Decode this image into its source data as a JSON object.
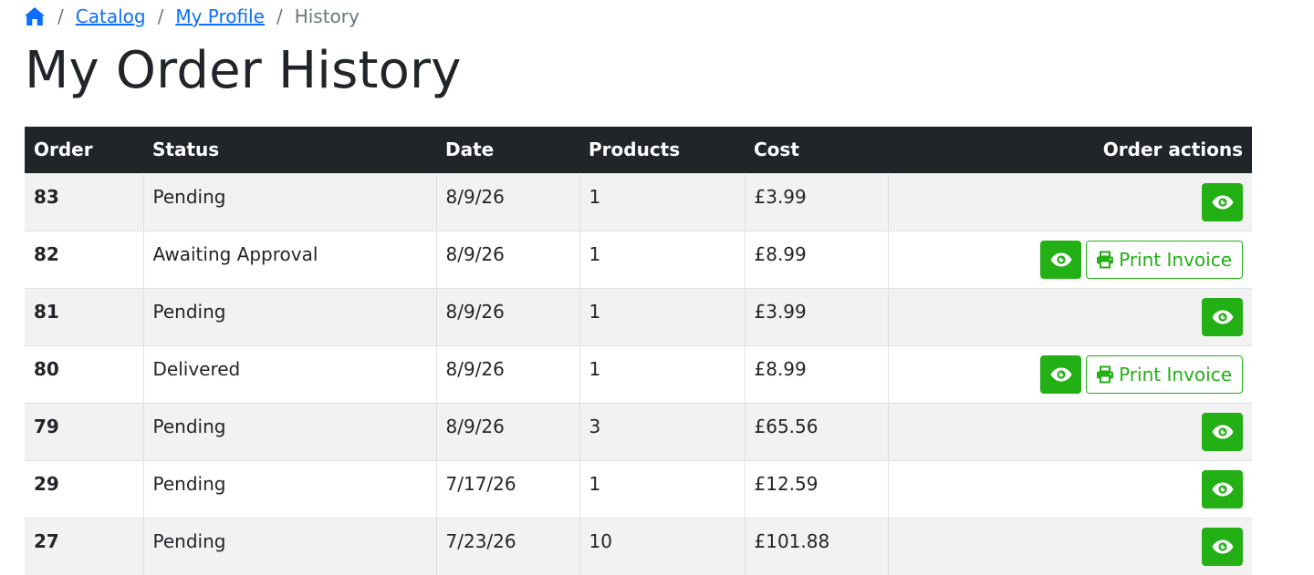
{
  "breadcrumb": {
    "home_icon": "home-icon",
    "items": [
      {
        "label": "Catalog"
      },
      {
        "label": "My Profile"
      }
    ],
    "current": "History",
    "separator": "/"
  },
  "page_title": "My Order History",
  "table": {
    "headers": {
      "order": "Order",
      "status": "Status",
      "date": "Date",
      "products": "Products",
      "cost": "Cost",
      "actions": "Order actions"
    },
    "print_invoice_label": "Print Invoice",
    "rows": [
      {
        "order": "83",
        "status": "Pending",
        "date": "8/9/26",
        "products": "1",
        "cost": "£3.99",
        "printable": false
      },
      {
        "order": "82",
        "status": "Awaiting Approval",
        "date": "8/9/26",
        "products": "1",
        "cost": "£8.99",
        "printable": true
      },
      {
        "order": "81",
        "status": "Pending",
        "date": "8/9/26",
        "products": "1",
        "cost": "£3.99",
        "printable": false
      },
      {
        "order": "80",
        "status": "Delivered",
        "date": "8/9/26",
        "products": "1",
        "cost": "£8.99",
        "printable": true
      },
      {
        "order": "79",
        "status": "Pending",
        "date": "8/9/26",
        "products": "3",
        "cost": "£65.56",
        "printable": false
      },
      {
        "order": "29",
        "status": "Pending",
        "date": "7/17/26",
        "products": "1",
        "cost": "£12.59",
        "printable": false
      },
      {
        "order": "27",
        "status": "Pending",
        "date": "7/23/26",
        "products": "10",
        "cost": "£101.88",
        "printable": false
      }
    ]
  },
  "colors": {
    "link": "#0d6efd",
    "header_bg": "#212529",
    "accent_green": "#22b014",
    "stripe": "#f2f2f2"
  }
}
